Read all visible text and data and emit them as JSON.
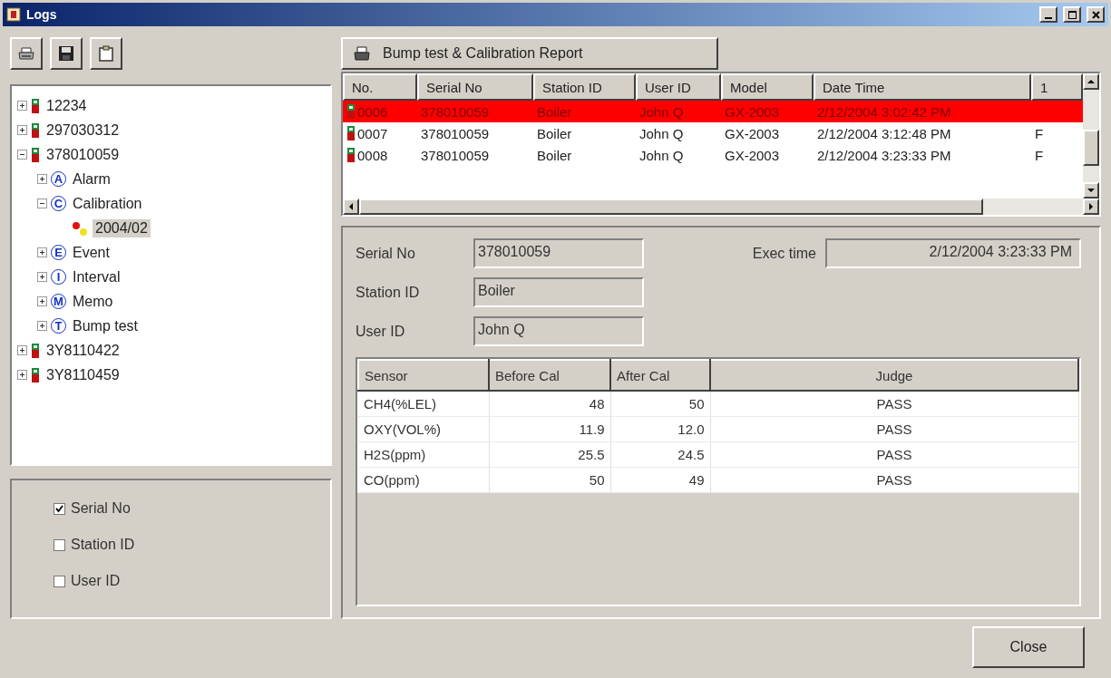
{
  "window": {
    "title": "Logs"
  },
  "tree": [
    {
      "label": "12234",
      "kind": "device",
      "expanded": false,
      "selected": false
    },
    {
      "label": "297030312",
      "kind": "device",
      "expanded": false,
      "selected": false
    },
    {
      "label": "378010059",
      "kind": "device",
      "expanded": true,
      "selected": false,
      "children": [
        {
          "label": "Alarm",
          "kind": "category",
          "badge": "A",
          "expanded": false,
          "selected": false
        },
        {
          "label": "Calibration",
          "kind": "category",
          "badge": "C",
          "expanded": true,
          "selected": false,
          "children": [
            {
              "label": "2004/02",
              "kind": "record",
              "selected": true
            }
          ]
        },
        {
          "label": "Event",
          "kind": "category",
          "badge": "E",
          "expanded": false,
          "selected": false
        },
        {
          "label": "Interval",
          "kind": "category",
          "badge": "I",
          "expanded": false,
          "selected": false
        },
        {
          "label": "Memo",
          "kind": "category",
          "badge": "M",
          "expanded": false,
          "selected": false
        },
        {
          "label": "Bump test",
          "kind": "category",
          "badge": "T",
          "expanded": false,
          "selected": false
        }
      ]
    },
    {
      "label": "3Y8110422",
      "kind": "device",
      "expanded": false,
      "selected": false
    },
    {
      "label": "3Y8110459",
      "kind": "device",
      "expanded": false,
      "selected": false
    }
  ],
  "filters": [
    {
      "label": "Serial No",
      "checked": true
    },
    {
      "label": "Station ID",
      "checked": false
    },
    {
      "label": "User ID",
      "checked": false
    }
  ],
  "report_button": {
    "label": "Bump test & Calibration Report"
  },
  "records": {
    "columns": [
      "No.",
      "Serial No",
      "Station ID",
      "User ID",
      "Model",
      "Date Time",
      "1"
    ],
    "rows": [
      {
        "selected": true,
        "cells": [
          "0006",
          "378010059",
          "Boiler",
          "John Q",
          "GX-2003",
          "2/12/2004 3:02:42 PM"
        ]
      },
      {
        "selected": false,
        "cells": [
          "0007",
          "378010059",
          "Boiler",
          "John Q",
          "GX-2003",
          "2/12/2004 3:12:48 PM",
          "F"
        ]
      },
      {
        "selected": false,
        "cells": [
          "0008",
          "378010059",
          "Boiler",
          "John Q",
          "GX-2003",
          "2/12/2004 3:23:33 PM",
          "F"
        ]
      }
    ]
  },
  "details": {
    "fields": [
      {
        "label": "Serial No",
        "value": "378010059"
      },
      {
        "label": "Station ID",
        "value": "Boiler"
      },
      {
        "label": "User ID",
        "value": "John Q"
      }
    ],
    "exec_time": {
      "label": "Exec time",
      "value": "2/12/2004 3:23:33 PM"
    },
    "sensors": {
      "columns": [
        "Sensor",
        "Before Cal",
        "After Cal",
        "Judge"
      ],
      "rows": [
        [
          "CH4(%LEL)",
          "48",
          "50",
          "PASS"
        ],
        [
          "OXY(VOL%)",
          "11.9",
          "12.0",
          "PASS"
        ],
        [
          "H2S(ppm)",
          "25.5",
          "24.5",
          "PASS"
        ],
        [
          "CO(ppm)",
          "50",
          "49",
          "PASS"
        ]
      ]
    }
  },
  "close_button": {
    "label": "Close"
  }
}
